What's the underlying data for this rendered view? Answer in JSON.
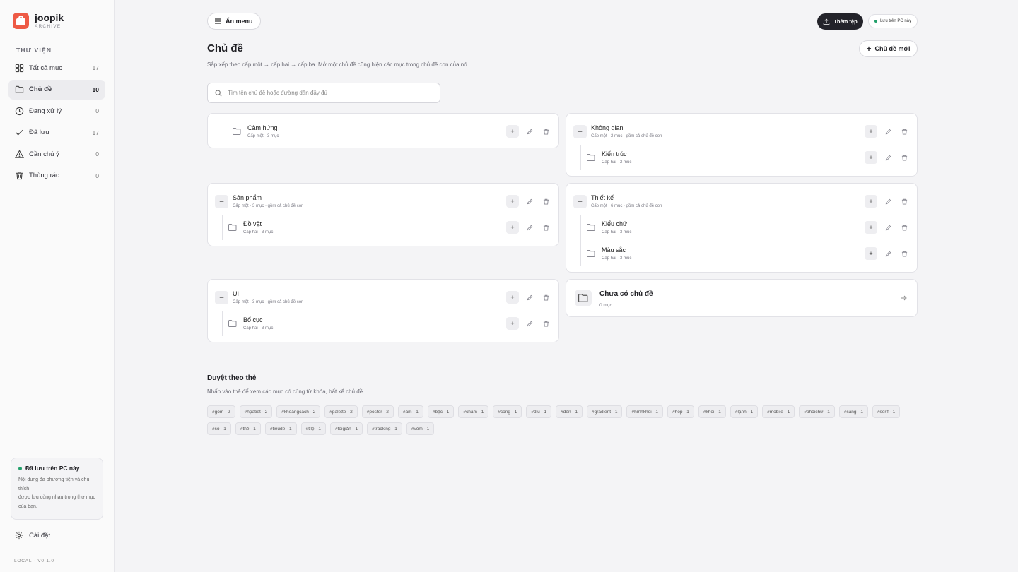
{
  "brand": {
    "name": "joopik",
    "sub": "ARCHIVE"
  },
  "sidebar": {
    "section": "THƯ VIỆN",
    "items": [
      {
        "label": "Tất cả mục",
        "count": "17",
        "icon": "grid-icon"
      },
      {
        "label": "Chủ đề",
        "count": "10",
        "icon": "folder-icon"
      },
      {
        "label": "Đang xử lý",
        "count": "0",
        "icon": "clock-icon"
      },
      {
        "label": "Đã lưu",
        "count": "17",
        "icon": "check-icon"
      },
      {
        "label": "Cần chú ý",
        "count": "0",
        "icon": "warning-icon"
      },
      {
        "label": "Thùng rác",
        "count": "0",
        "icon": "trash-icon"
      }
    ],
    "note_title": "Đã lưu trên PC này",
    "note_body": "Nội dung đa phương tiện và chú thích\nđược lưu cùng nhau trong thư mục của bạn.",
    "settings": "Cài đặt",
    "version": "LOCAL · V0.1.0"
  },
  "top": {
    "hide_menu": "Ẩn menu",
    "add_file": "Thêm tệp",
    "saved_local": "Lưu trên PC này",
    "title": "Chủ đề",
    "description": "Sắp xếp theo cấp một → cấp hai → cấp ba. Mở một chủ đề cũng hiện các mục trong chủ đề con của nó.",
    "new_topic": "Chủ đề mới",
    "search_placeholder": "Tìm tên chủ đề hoặc đường dẫn đầy đủ"
  },
  "topics": {
    "t1": {
      "name": "Cảm hứng",
      "meta": "Cấp một · 3 mục"
    },
    "t2": {
      "name": "Không gian",
      "meta": "Cấp một · 2 mục · gồm cả chủ đề con"
    },
    "t2c1": {
      "name": "Kiến trúc",
      "meta": "Cấp hai · 2 mục"
    },
    "t3": {
      "name": "Sản phẩm",
      "meta": "Cấp một · 3 mục · gồm cả chủ đề con"
    },
    "t3c1": {
      "name": "Đồ vật",
      "meta": "Cấp hai · 3 mục"
    },
    "t4": {
      "name": "Thiết kế",
      "meta": "Cấp một · 6 mục · gồm cả chủ đề con"
    },
    "t4c1": {
      "name": "Kiểu chữ",
      "meta": "Cấp hai · 3 mục"
    },
    "t4c2": {
      "name": "Màu sắc",
      "meta": "Cấp hai · 3 mục"
    },
    "t5": {
      "name": "UI",
      "meta": "Cấp một · 3 mục · gồm cả chủ đề con"
    },
    "t5c1": {
      "name": "Bố cục",
      "meta": "Cấp hai · 3 mục"
    },
    "none": {
      "name": "Chưa có chủ đề",
      "meta": "0 mục"
    }
  },
  "tags": {
    "title": "Duyệt theo thẻ",
    "description": "Nhấp vào thẻ để xem các mục có cùng từ khóa, bất kể chủ đề.",
    "list": [
      "#gồm · 2",
      "#họatiết · 2",
      "#khoảngcách · 2",
      "#palette · 2",
      "#poster · 2",
      "#ấm · 1",
      "#bậc · 1",
      "#chấm · 1",
      "#cong · 1",
      "#dịu · 1",
      "#đèn · 1",
      "#gradient · 1",
      "#hìnhkhối · 1",
      "#hop · 1",
      "#khối · 1",
      "#lạnh · 1",
      "#mobile · 1",
      "#phốichữ · 1",
      "#sáng · 1",
      "#serif · 1",
      "#số · 1",
      "#thẻ · 1",
      "#tiêuđề · 1",
      "#tỉlệ · 1",
      "#tốigiản · 1",
      "#tracking · 1",
      "#vòm · 1"
    ]
  },
  "colors": {
    "accent": "#ee5a45",
    "dark_button": "#23232a",
    "status_green": "#22a06b"
  }
}
